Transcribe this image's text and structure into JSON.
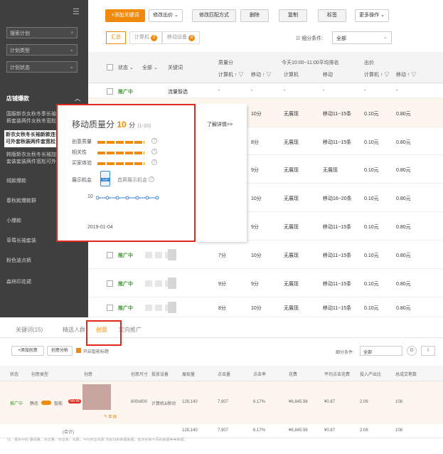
{
  "sidebar": {
    "search_placeholder": "搜索计划",
    "plan_type": "计划类型",
    "plan_status": "计划状态",
    "group_title": "店铺爆款",
    "item1": "国服新衣女秋冬季长袖",
    "item1b": "裤套装两件女秋冬宽松",
    "item2": "新衣女秋冬长袖新款连衣",
    "item2b": "可外套秋装两件套宽松",
    "item3": "韩版新衣女秋冬长袖加厚",
    "item3b": "套装套装两件宽松可外",
    "items": [
      "绒款爆款",
      "春秋款爆款群",
      "小爆款",
      "草莓长袖套装",
      "粉色波点裤",
      "森林印花裙"
    ]
  },
  "toolbar": {
    "add": "+添加关键词",
    "modify_bid": "修改出价",
    "modify_match": "修改匹配方式",
    "delete": "删除",
    "copy": "复制",
    "tag": "标签",
    "more": "更多操作"
  },
  "tabs": {
    "summary": "汇总",
    "pc": "计算机",
    "pc_count": "8",
    "mobile": "移动设备",
    "mobile_count": "8"
  },
  "filter": {
    "label": "细分条件:",
    "value": "全部"
  },
  "table_header": {
    "status": "状态",
    "all": "全部",
    "keyword": "关键词",
    "quality": "质量分",
    "rank_title": "今天10:00~11:00平均排名",
    "bid": "出价",
    "pc": "计算机",
    "mobile": "移动",
    "pc_rank": "计算机",
    "mobile_rank": "移动",
    "pc_bid": "计算机",
    "mobile_bid": "移动"
  },
  "rows": [
    {
      "status": "推广中",
      "keyword": "流量智选",
      "pc_q": "-",
      "mobile_q": "-",
      "pc_rank": "-",
      "mobile_rank": "-",
      "pc_bid": "-",
      "mobile_bid": "-"
    },
    {
      "status": "",
      "keyword": "",
      "pc_q": "",
      "mobile_q": "10分",
      "pc_rank": "无展现",
      "mobile_rank": "移动11~15条",
      "pc_bid": "0.10元",
      "mobile_bid": "0.80元"
    },
    {
      "status": "",
      "keyword": "",
      "pc_q": "",
      "mobile_q": "8分",
      "pc_rank": "无展现",
      "mobile_rank": "移动11~15条",
      "pc_bid": "0.10元",
      "mobile_bid": "0.80元"
    },
    {
      "status": "",
      "keyword": "",
      "pc_q": "",
      "mobile_q": "9分",
      "pc_rank": "无展现",
      "mobile_rank": "无展现",
      "pc_bid": "0.10元",
      "mobile_bid": "0.80元"
    },
    {
      "status": "",
      "keyword": "",
      "pc_q": "",
      "mobile_q": "10分",
      "pc_rank": "无展现",
      "mobile_rank": "移动16~20条",
      "pc_bid": "0.10元",
      "mobile_bid": "0.80元"
    },
    {
      "status": "",
      "keyword": "",
      "pc_q": "",
      "mobile_q": "9分",
      "pc_rank": "无展现",
      "mobile_rank": "移动11~15条",
      "pc_bid": "0.10元",
      "mobile_bid": "0.80元"
    },
    {
      "status": "推广中",
      "keyword": "",
      "pc_q": "7分",
      "mobile_q": "10分",
      "pc_rank": "无展现",
      "mobile_rank": "移动11~15条",
      "pc_bid": "0.10元",
      "mobile_bid": "0.80元"
    },
    {
      "status": "推广中",
      "keyword": "",
      "pc_q": "9分",
      "mobile_q": "9分",
      "pc_rank": "无展现",
      "mobile_rank": "移动11~15条",
      "pc_bid": "0.10元",
      "mobile_bid": "0.80元"
    },
    {
      "status": "推广中",
      "keyword": "",
      "pc_q": "8分",
      "mobile_q": "10分",
      "pc_rank": "无展现",
      "mobile_rank": "移动11~15条",
      "pc_bid": "0.10元",
      "mobile_bid": "0.80元"
    }
  ],
  "popup": {
    "title": "移动质量分",
    "score": "10",
    "unit": "分",
    "range": "(1-10)",
    "detail": "了解详情>>",
    "creative": "创意质量",
    "relevance": "相关性",
    "experience": "买家体验",
    "display": "展示机会",
    "top_badge": "TOP",
    "display_text": "首屏展示机会",
    "chart_y": "10",
    "chart_date": "2019-01-04"
  },
  "bottom": {
    "tabs": [
      "关键词(15)",
      "精选人群",
      "创意",
      "定向推广"
    ],
    "add_creative": "+添加创意",
    "creative_split": "创意分析",
    "smart_label": "开启智能标题",
    "filter_label": "细分条件:",
    "filter_value": "全部",
    "headers": [
      "状态",
      "创意类型",
      "创意",
      "创意尺寸",
      "投放设备",
      "展现量",
      "点击量",
      "点击率",
      "花费",
      "平均点击花费",
      "投入产出比",
      "总成交笔数"
    ],
    "row": {
      "status": "推广中",
      "type": "静态",
      "smart": "智能",
      "new": "NEW",
      "size": "800x800",
      "device": "计算机&移动",
      "impr": "128,140",
      "clicks": "7,907",
      "ctr": "6.17%",
      "cost": "¥6,845.98",
      "cpc": "¥0.87",
      "roi": "2.06",
      "orders": "108"
    },
    "total": {
      "label": "(合计)",
      "impr": "128,140",
      "clicks": "7,907",
      "ctr": "6.17%",
      "cost": "¥6,845.98",
      "cpc": "¥0.87",
      "roi": "2.06",
      "orders": "108"
    },
    "note": "注：报表中的\"展现量、点击量、点击率、花费、平均点击花费\"为前日的数据数据，若对实际不同的数据等等数据。"
  }
}
